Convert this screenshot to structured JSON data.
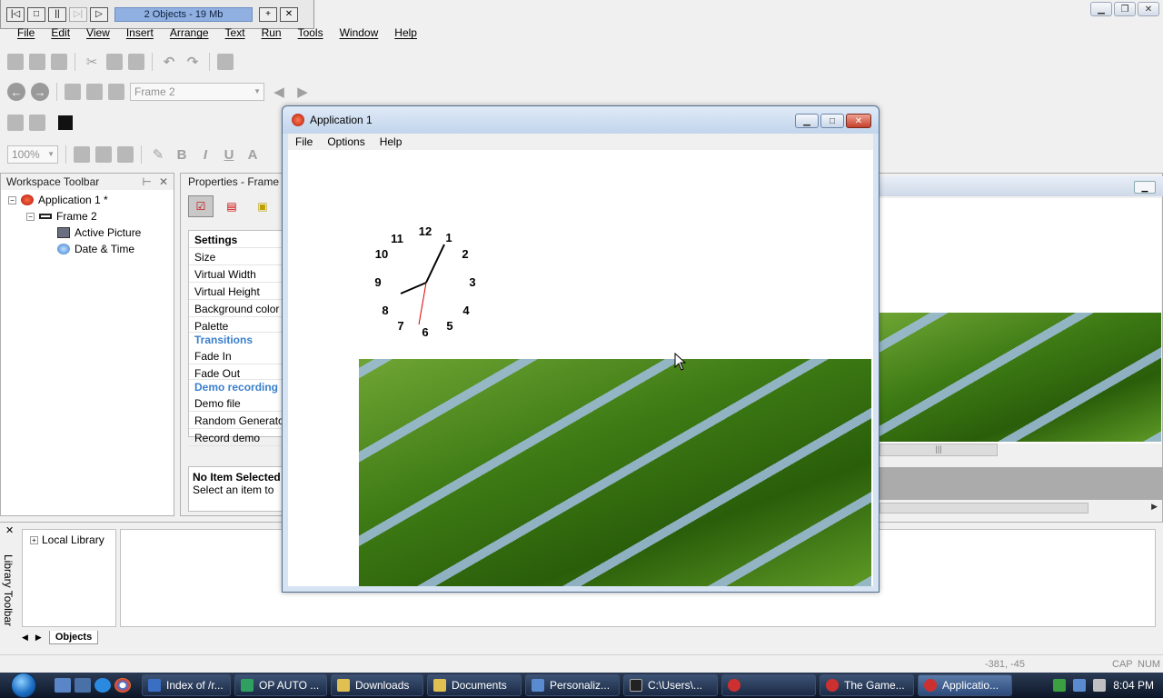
{
  "runtime_toolbar": {
    "status": "2 Objects - 19 Mb"
  },
  "menubar": [
    "File",
    "Edit",
    "View",
    "Insert",
    "Arrange",
    "Text",
    "Run",
    "Tools",
    "Window",
    "Help"
  ],
  "toolbar": {
    "frame_combo": "Frame 2",
    "zoom_combo": "100%"
  },
  "workspace": {
    "title": "Workspace Toolbar",
    "tree": {
      "app": "Application 1 *",
      "frame": "Frame 2",
      "children": [
        "Active Picture",
        "Date & Time"
      ]
    }
  },
  "properties": {
    "title": "Properties - Frame",
    "header": "Settings",
    "rows1": [
      "Size",
      "Virtual Width",
      "Virtual Height",
      "Background color",
      "Palette"
    ],
    "section_transitions": "Transitions",
    "rows2": [
      "Fade In",
      "Fade Out"
    ],
    "section_demo": "Demo recording",
    "rows3": [
      "Demo file",
      "Random Generator",
      "Record demo"
    ],
    "info_title": "No Item Selected",
    "info_text": "Select an item to"
  },
  "library": {
    "vertical_label": "Library Toolbar",
    "tree_item": "Local Library",
    "tab": "Objects"
  },
  "statusbar": {
    "coords": "-381, -45",
    "caps": "CAP",
    "num": "NUM"
  },
  "app_window": {
    "title": "Application 1",
    "menu": [
      "File",
      "Options",
      "Help"
    ],
    "clock_numbers": [
      "12",
      "1",
      "2",
      "3",
      "4",
      "5",
      "6",
      "7",
      "8",
      "9",
      "10",
      "11"
    ]
  },
  "taskbar": {
    "tasks": [
      {
        "label": "Index of /r...",
        "color": "#3a6fc4"
      },
      {
        "label": "OP AUTO ...",
        "color": "#2fa060"
      },
      {
        "label": "Downloads",
        "color": "#e0c050"
      },
      {
        "label": "Documents",
        "color": "#e0c050"
      },
      {
        "label": "Personaliz...",
        "color": "#5a8ad0"
      },
      {
        "label": "C:\\Users\\...",
        "color": "#222222"
      },
      {
        "label": "",
        "color": "#cc3030"
      },
      {
        "label": "The Game...",
        "color": "#cc3030"
      },
      {
        "label": "Applicatio...",
        "color": "#cc3030",
        "active": true
      }
    ],
    "time": "8:04 PM"
  }
}
